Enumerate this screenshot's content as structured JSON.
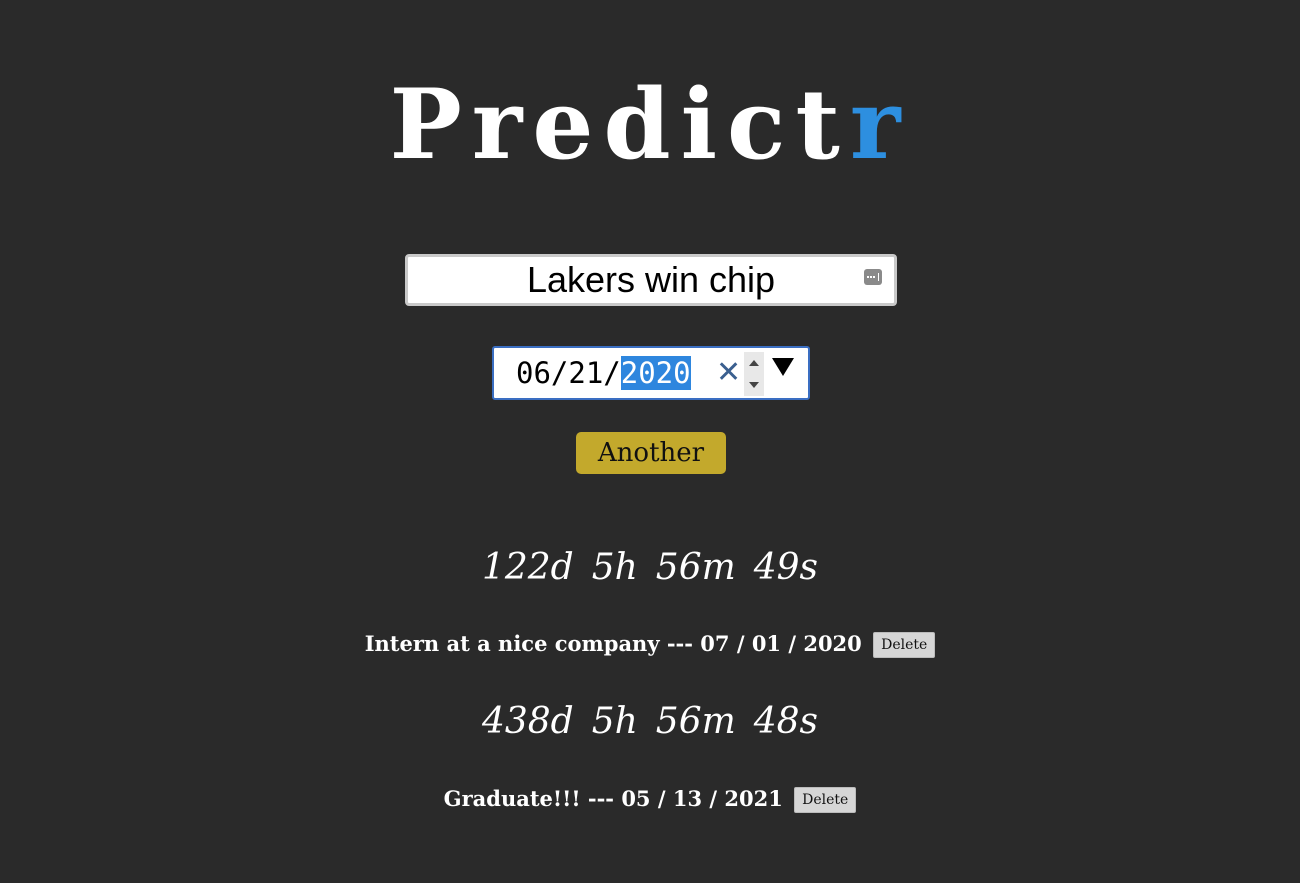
{
  "logo": {
    "main": "Predict",
    "accent": "r",
    "accent_color": "#2d8fe0"
  },
  "prediction_input": {
    "value": "Lakers win chip",
    "autofill_icon": "password-manager-icon"
  },
  "date_input": {
    "prefix": "06/21/",
    "selected": "2020",
    "clear_icon": "clear-icon",
    "dropdown_icon": "dropdown-arrow-icon"
  },
  "another_button": {
    "label": "Another",
    "color": "#c3a92c"
  },
  "predictions": [
    {
      "countdown": {
        "days": "122d",
        "hours": "5h",
        "minutes": "56m",
        "seconds": "49s"
      },
      "text": "Intern at a nice company --- 07 / 01 / 2020",
      "delete_label": "Delete"
    },
    {
      "countdown": {
        "days": "438d",
        "hours": "5h",
        "minutes": "56m",
        "seconds": "48s"
      },
      "text": "Graduate!!! --- 05 / 13 / 2021",
      "delete_label": "Delete"
    }
  ]
}
